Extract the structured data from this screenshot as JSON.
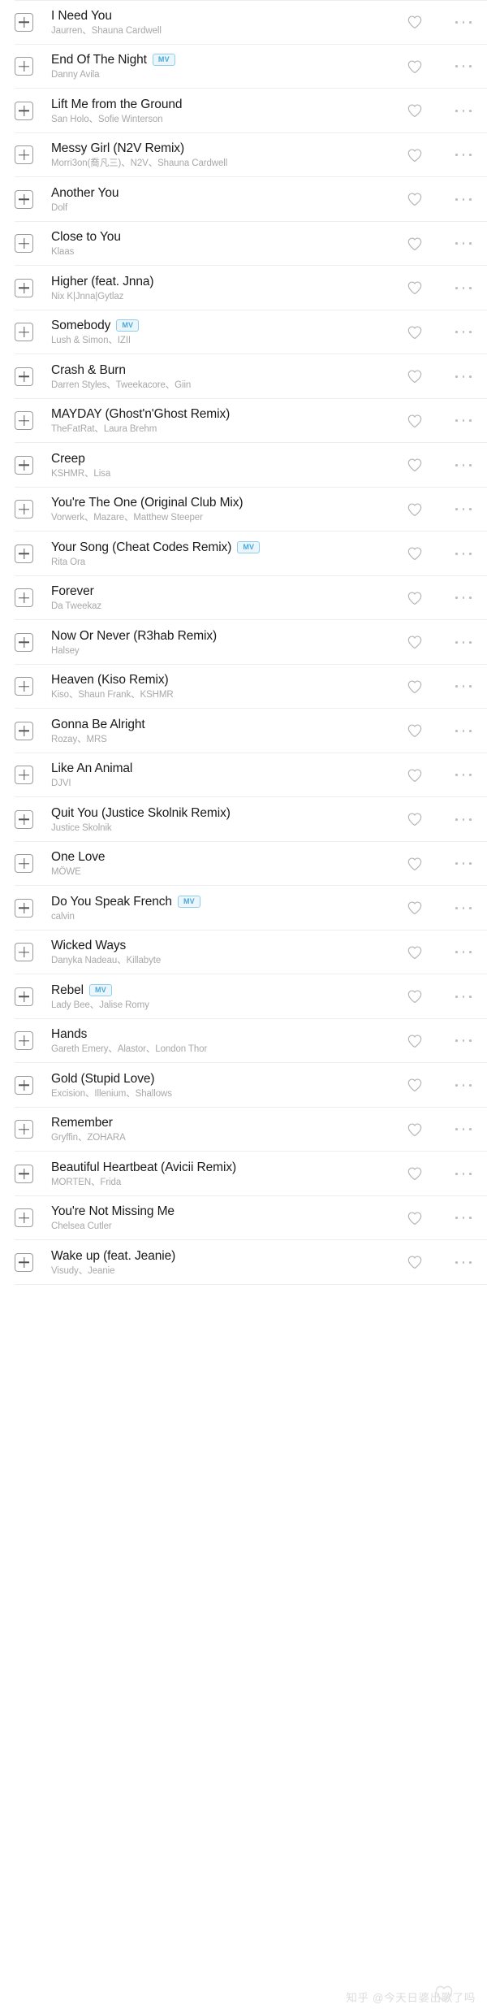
{
  "icons": {
    "add": "plus-icon",
    "favorite": "heart-icon",
    "more": "more-options-icon"
  },
  "colors": {
    "title": "#1a1a1a",
    "artist": "#a8a8a8",
    "divider": "#ededed",
    "mv_badge_text": "#4aa8d8",
    "mv_badge_bg": "#eaf6fc",
    "mv_badge_border": "#8fcdea",
    "icon_gray": "#b5b5b5",
    "watermark": "#dcdcdc"
  },
  "badge_label": "MV",
  "watermark": {
    "text": "知乎 @今天日婆出歌了吗"
  },
  "songs": [
    {
      "title": "I Need You",
      "artist": "Jaurren、Shauna Cardwell",
      "mv": ""
    },
    {
      "title": "End Of The Night",
      "artist": "Danny Avila",
      "mv": "MV"
    },
    {
      "title": "Lift Me from the Ground",
      "artist": "San Holo、Sofie Winterson",
      "mv": ""
    },
    {
      "title": "Messy Girl (N2V Remix)",
      "artist": "Morri3on(喬凡三)、N2V、Shauna Cardwell",
      "mv": ""
    },
    {
      "title": "Another You",
      "artist": "Dolf",
      "mv": ""
    },
    {
      "title": "Close to You",
      "artist": "Klaas",
      "mv": ""
    },
    {
      "title": "Higher (feat. Jnna)",
      "artist": "Nix K|Jnna|Gytlaz",
      "mv": ""
    },
    {
      "title": "Somebody",
      "artist": "Lush & Simon、IZII",
      "mv": "MV"
    },
    {
      "title": "Crash & Burn",
      "artist": "Darren Styles、Tweekacore、Giin",
      "mv": ""
    },
    {
      "title": "MAYDAY (Ghost'n'Ghost Remix)",
      "artist": "TheFatRat、Laura Brehm",
      "mv": ""
    },
    {
      "title": "Creep",
      "artist": "KSHMR、Lisa",
      "mv": ""
    },
    {
      "title": "You're The One (Original Club Mix)",
      "artist": "Vorwerk、Mazare、Matthew Steeper",
      "mv": ""
    },
    {
      "title": "Your Song (Cheat Codes Remix)",
      "artist": "Rita Ora",
      "mv": "MV"
    },
    {
      "title": "Forever",
      "artist": "Da Tweekaz",
      "mv": ""
    },
    {
      "title": "Now Or Never (R3hab Remix)",
      "artist": "Halsey",
      "mv": ""
    },
    {
      "title": "Heaven (Kiso Remix)",
      "artist": "Kiso、Shaun Frank、KSHMR",
      "mv": ""
    },
    {
      "title": "Gonna Be Alright",
      "artist": "Rozay、MRS",
      "mv": ""
    },
    {
      "title": "Like An Animal",
      "artist": "DJVI",
      "mv": ""
    },
    {
      "title": "Quit You (Justice Skolnik Remix)",
      "artist": "Justice Skolnik",
      "mv": ""
    },
    {
      "title": "One Love",
      "artist": "MÖWE",
      "mv": ""
    },
    {
      "title": "Do You Speak French",
      "artist": "calvin",
      "mv": "MV"
    },
    {
      "title": "Wicked Ways",
      "artist": "Danyka Nadeau、Killabyte",
      "mv": ""
    },
    {
      "title": "Rebel",
      "artist": "Lady Bee、Jalise Romy",
      "mv": "MV"
    },
    {
      "title": "Hands",
      "artist": "Gareth Emery、Alastor、London Thor",
      "mv": ""
    },
    {
      "title": "Gold (Stupid Love)",
      "artist": "Excision、Illenium、Shallows",
      "mv": ""
    },
    {
      "title": "Remember",
      "artist": "Gryffin、ZOHARA",
      "mv": ""
    },
    {
      "title": "Beautiful Heartbeat (Avicii Remix)",
      "artist": "MORTEN、Frida",
      "mv": ""
    },
    {
      "title": "You're Not Missing Me",
      "artist": "Chelsea Cutler",
      "mv": ""
    },
    {
      "title": "Wake up (feat. Jeanie)",
      "artist": "Visudy、Jeanie",
      "mv": ""
    }
  ]
}
